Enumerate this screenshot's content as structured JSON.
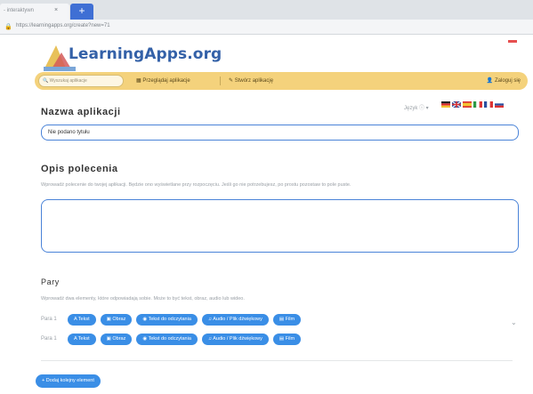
{
  "browser": {
    "tab_title": "- interaktywn",
    "tab_close": "×",
    "new_tab": "+",
    "url": "https://learningapps.org/create?new=71",
    "lock": "🔒"
  },
  "header": {
    "logo_text": "LearningApps.org",
    "search_placeholder": "Wyszukaj aplikacje",
    "nav_browse": "Przeglądaj aplikacje",
    "nav_create": "Stwórz aplikację",
    "nav_login": "Zaloguj się"
  },
  "form": {
    "app_name_title": "Nazwa aplikacji",
    "language_label": "Język",
    "title_input_value": "Nie podano tytułu",
    "description_title": "Opis polecenia",
    "description_hint": "Wprowadź polecenie do twojej aplikacji. Będzie ono wyświetlane przy rozpoczęciu. Jeśli go nie potrzebujesz, po prostu pozostaw to pole puste.",
    "pairs_title": "Pary",
    "pairs_hint": "Wprowadź dwa elementy, które odpowiadają sobie. Może to być tekst, obraz, audio lub wideo.",
    "pair_rows": [
      {
        "label": "Para 1",
        "buttons": [
          "A Tekst",
          "Obraz",
          "Tekst do odczytania",
          "Audio / Plik dźwiękowy",
          "Film"
        ]
      },
      {
        "label": "Para 1",
        "buttons": [
          "A Tekst",
          "Obraz",
          "Tekst do odczytania",
          "Audio / Plik dźwiękowy",
          "Film"
        ]
      }
    ],
    "add_element": "+ Dodaj kolejny element"
  },
  "colors": {
    "accent": "#3a8ee6",
    "navbar": "#f4d27c",
    "input_border": "#4a83d8",
    "logo": "#3461a8"
  },
  "icons": {
    "flags": [
      "flag-germany-icon",
      "flag-uk-icon",
      "flag-spain-icon",
      "flag-italy-icon",
      "flag-france-icon",
      "flag-russia-icon"
    ]
  }
}
